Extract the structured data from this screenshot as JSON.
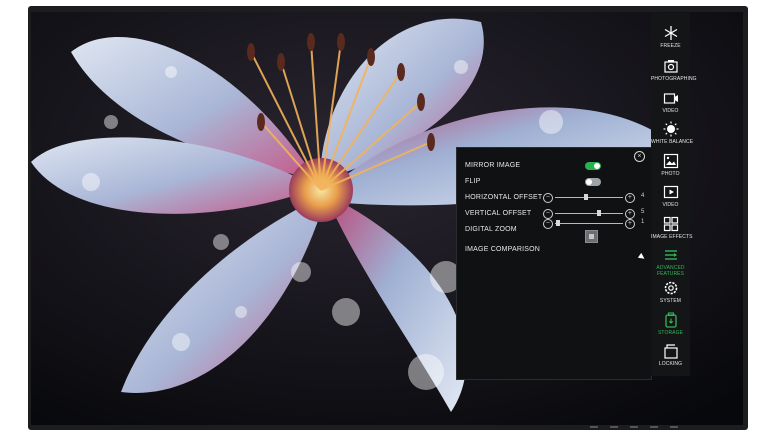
{
  "settings_panel": {
    "mirror_image": {
      "label": "MIRROR IMAGE",
      "on": true
    },
    "flip": {
      "label": "FLIP",
      "on": false
    },
    "horizontal_offset": {
      "label": "HORIZONTAL OFFSET",
      "value": "4",
      "level": 0.45
    },
    "vertical_offset": {
      "label": "VERTICAL OFFSET",
      "value": "5",
      "level": 0.65
    },
    "digital_zoom": {
      "label": "DIGITAL ZOOM",
      "value": "1",
      "level": 0.05
    },
    "image_comparison": {
      "label": "IMAGE COMPARISON"
    }
  },
  "sidebar": {
    "items": [
      {
        "label": "FREEZE",
        "icon": "snowflake-icon"
      },
      {
        "label": "PHOTOGRAPHING",
        "icon": "camera-icon"
      },
      {
        "label": "VIDEO",
        "icon": "video-icon"
      },
      {
        "label": "WHITE BALANCE",
        "icon": "white-balance-icon"
      },
      {
        "label": "PHOTO",
        "icon": "photo-icon"
      },
      {
        "label": "VIDEO",
        "icon": "video-file-icon"
      },
      {
        "label": "IMAGE EFFECTS",
        "icon": "image-effects-icon"
      },
      {
        "label": "ADVANCED FEATURES",
        "icon": "advanced-features-icon",
        "active": true
      },
      {
        "label": "SYSTEM",
        "icon": "gear-icon"
      },
      {
        "label": "STORAGE",
        "icon": "storage-icon",
        "active": true
      },
      {
        "label": "LOCKING",
        "icon": "lock-icon"
      }
    ]
  },
  "colors": {
    "accent": "#33b455",
    "panel_bg": "#101112",
    "toggle_off": "#9ea3a8"
  }
}
